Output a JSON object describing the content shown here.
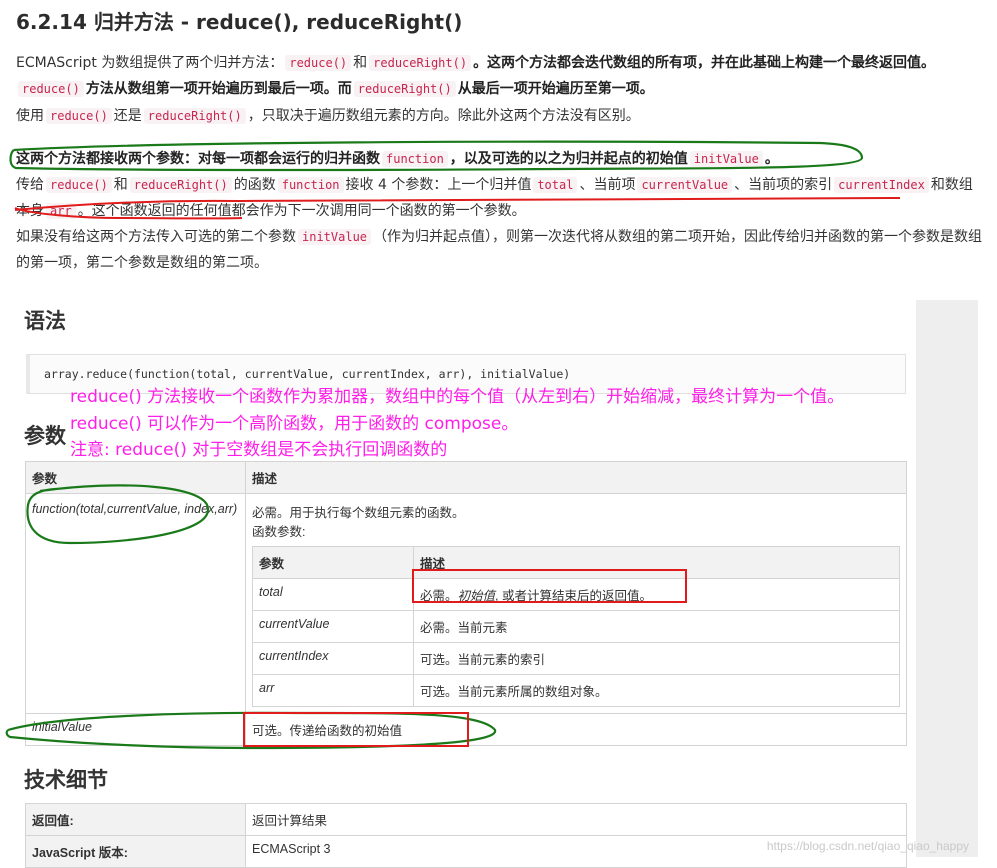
{
  "heading": "6.2.14 归并方法 - reduce(), reduceRight()",
  "para1": {
    "t1": "ECMAScript 为数组提供了两个归并方法：",
    "c1": "reduce()",
    "t2": "和",
    "c2": "reduceRight()",
    "b1": "。这两个方法都会迭代数组的所有项，并在此基础上构建一个最终返回值。",
    "c3": "reduce()",
    "b2": "方法从数组第一项开始遍历到最后一项。而",
    "c4": "reduceRight()",
    "b3": "从最后一项开始遍历至第一项。"
  },
  "para2": {
    "t1": "使用",
    "c1": "reduce()",
    "t2": "还是",
    "c2": "reduceRight()",
    "t3": "，只取决于遍历数组元素的方向。除此外这两个方法没有区别。"
  },
  "para3": {
    "b1": "这两个方法都接收两个参数：对每一项都会运行的归并函数",
    "c1": "function",
    "b2": "，以及可选的以之为归并起点的初始值",
    "c2": "initValue",
    "b3": "。"
  },
  "para4": {
    "t1": "传给",
    "c1": "reduce()",
    "t2": "和",
    "c2": "reduceRight()",
    "t3": "的函数",
    "c3": "function",
    "t4": "接收 4 个参数：上一个归并值",
    "c4": "total",
    "t5": "、当前项",
    "c5": "currentValue",
    "t6": "、当前项的索引",
    "c6": "currentIndex",
    "t7": "和数组本身",
    "c7": "arr",
    "t8": "。这个函数返回的任何值都会作为下一次调用同一个函数的第一个参数。"
  },
  "para5": {
    "t1": "如果没有给这两个方法传入可选的第二个参数",
    "c1": "initValue",
    "t2": "（作为归并起点值），则第一次迭代将从数组的第二项开始，因此传给归并函数的第一个参数是数组的第一项，第二个参数是数组的第二项。"
  },
  "syntax": {
    "title": "语法",
    "code": "array.reduce(function(total, currentValue, currentIndex, arr), initialValue)"
  },
  "notes": [
    "reduce() 方法接收一个函数作为累加器，数组中的每个值（从左到右）开始缩减，最终计算为一个值。",
    "reduce() 可以作为一个高阶函数，用于函数的 compose。",
    "注意: reduce() 对于空数组是不会执行回调函数的"
  ],
  "params": {
    "title": "参数",
    "col_param": "参数",
    "col_desc": "描述",
    "fn_name": "function(total,currentValue, index,arr)",
    "fn_desc1": "必需。用于执行每个数组元素的函数。",
    "fn_desc2": "函数参数:",
    "inner_col_param": "参数",
    "inner_col_desc": "描述",
    "inner_rows": [
      {
        "name": "total",
        "desc_pre": "必需。",
        "desc_em": "初始值",
        "desc_post": ", 或者计算结束后的返回值。"
      },
      {
        "name": "currentValue",
        "desc_pre": "必需。当前元素",
        "desc_em": "",
        "desc_post": ""
      },
      {
        "name": "currentIndex",
        "desc_pre": "可选。当前元素的索引",
        "desc_em": "",
        "desc_post": ""
      },
      {
        "name": "arr",
        "desc_pre": "可选。当前元素所属的数组对象。",
        "desc_em": "",
        "desc_post": ""
      }
    ],
    "init_name": "initialValue",
    "init_desc": "可选。传递给函数的初始值"
  },
  "tech": {
    "title": "技术细节",
    "rows": [
      {
        "key": "返回值:",
        "value": "返回计算结果"
      },
      {
        "key": "JavaScript 版本:",
        "value": "ECMAScript 3"
      }
    ]
  },
  "watermark": "https://blog.csdn.net/qiao_qiao_happy",
  "annotation_colors": {
    "green": "#1a7a1a",
    "red": "#e01b1b",
    "pink": "#ff1ee8"
  }
}
